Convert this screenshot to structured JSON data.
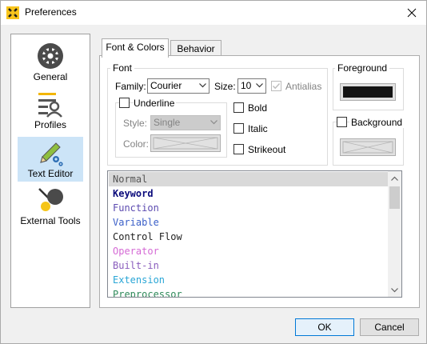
{
  "window": {
    "title": "Preferences",
    "app_icon": "x-logo-icon",
    "close_icon": "close-icon"
  },
  "nav": [
    {
      "label": "General",
      "icon": "gear-icon",
      "selected": false
    },
    {
      "label": "Profiles",
      "icon": "profile-list-icon",
      "selected": false
    },
    {
      "label": "Text Editor",
      "icon": "pencil-gears-icon",
      "selected": true
    },
    {
      "label": "External Tools",
      "icon": "external-tools-icon",
      "selected": false
    }
  ],
  "tabs": [
    {
      "label": "Font & Colors",
      "active": true
    },
    {
      "label": "Behavior",
      "active": false
    }
  ],
  "font_group": {
    "title": "Font",
    "family_label": "Family:",
    "family_value": "Courier",
    "size_label": "Size:",
    "size_value": "10",
    "antialias_label": "Antialias",
    "antialias_checked": true,
    "underline_label": "Underline",
    "style_label": "Style:",
    "style_value": "Single",
    "color_label": "Color:",
    "bold_label": "Bold",
    "italic_label": "Italic",
    "strikeout_label": "Strikeout"
  },
  "foreground": {
    "title": "Foreground",
    "color": "#141414"
  },
  "background": {
    "title": "Background",
    "checked": false
  },
  "syntax_items": [
    {
      "label": "Normal",
      "color": "#555555",
      "bold": false,
      "selected": true
    },
    {
      "label": "Keyword",
      "color": "#0c0c7c",
      "bold": true,
      "selected": false
    },
    {
      "label": "Function",
      "color": "#5c4bb0",
      "bold": false,
      "selected": false
    },
    {
      "label": "Variable",
      "color": "#3a5fc8",
      "bold": false,
      "selected": false
    },
    {
      "label": "Control Flow",
      "color": "#222222",
      "bold": false,
      "selected": false
    },
    {
      "label": "Operator",
      "color": "#d56ad5",
      "bold": false,
      "selected": false
    },
    {
      "label": "Built-in",
      "color": "#8a5dbd",
      "bold": false,
      "selected": false
    },
    {
      "label": "Extension",
      "color": "#2aa6d6",
      "bold": false,
      "selected": false
    },
    {
      "label": "Preprocessor",
      "color": "#2f8a5a",
      "bold": false,
      "selected": false
    }
  ],
  "buttons": {
    "ok": "OK",
    "cancel": "Cancel"
  }
}
